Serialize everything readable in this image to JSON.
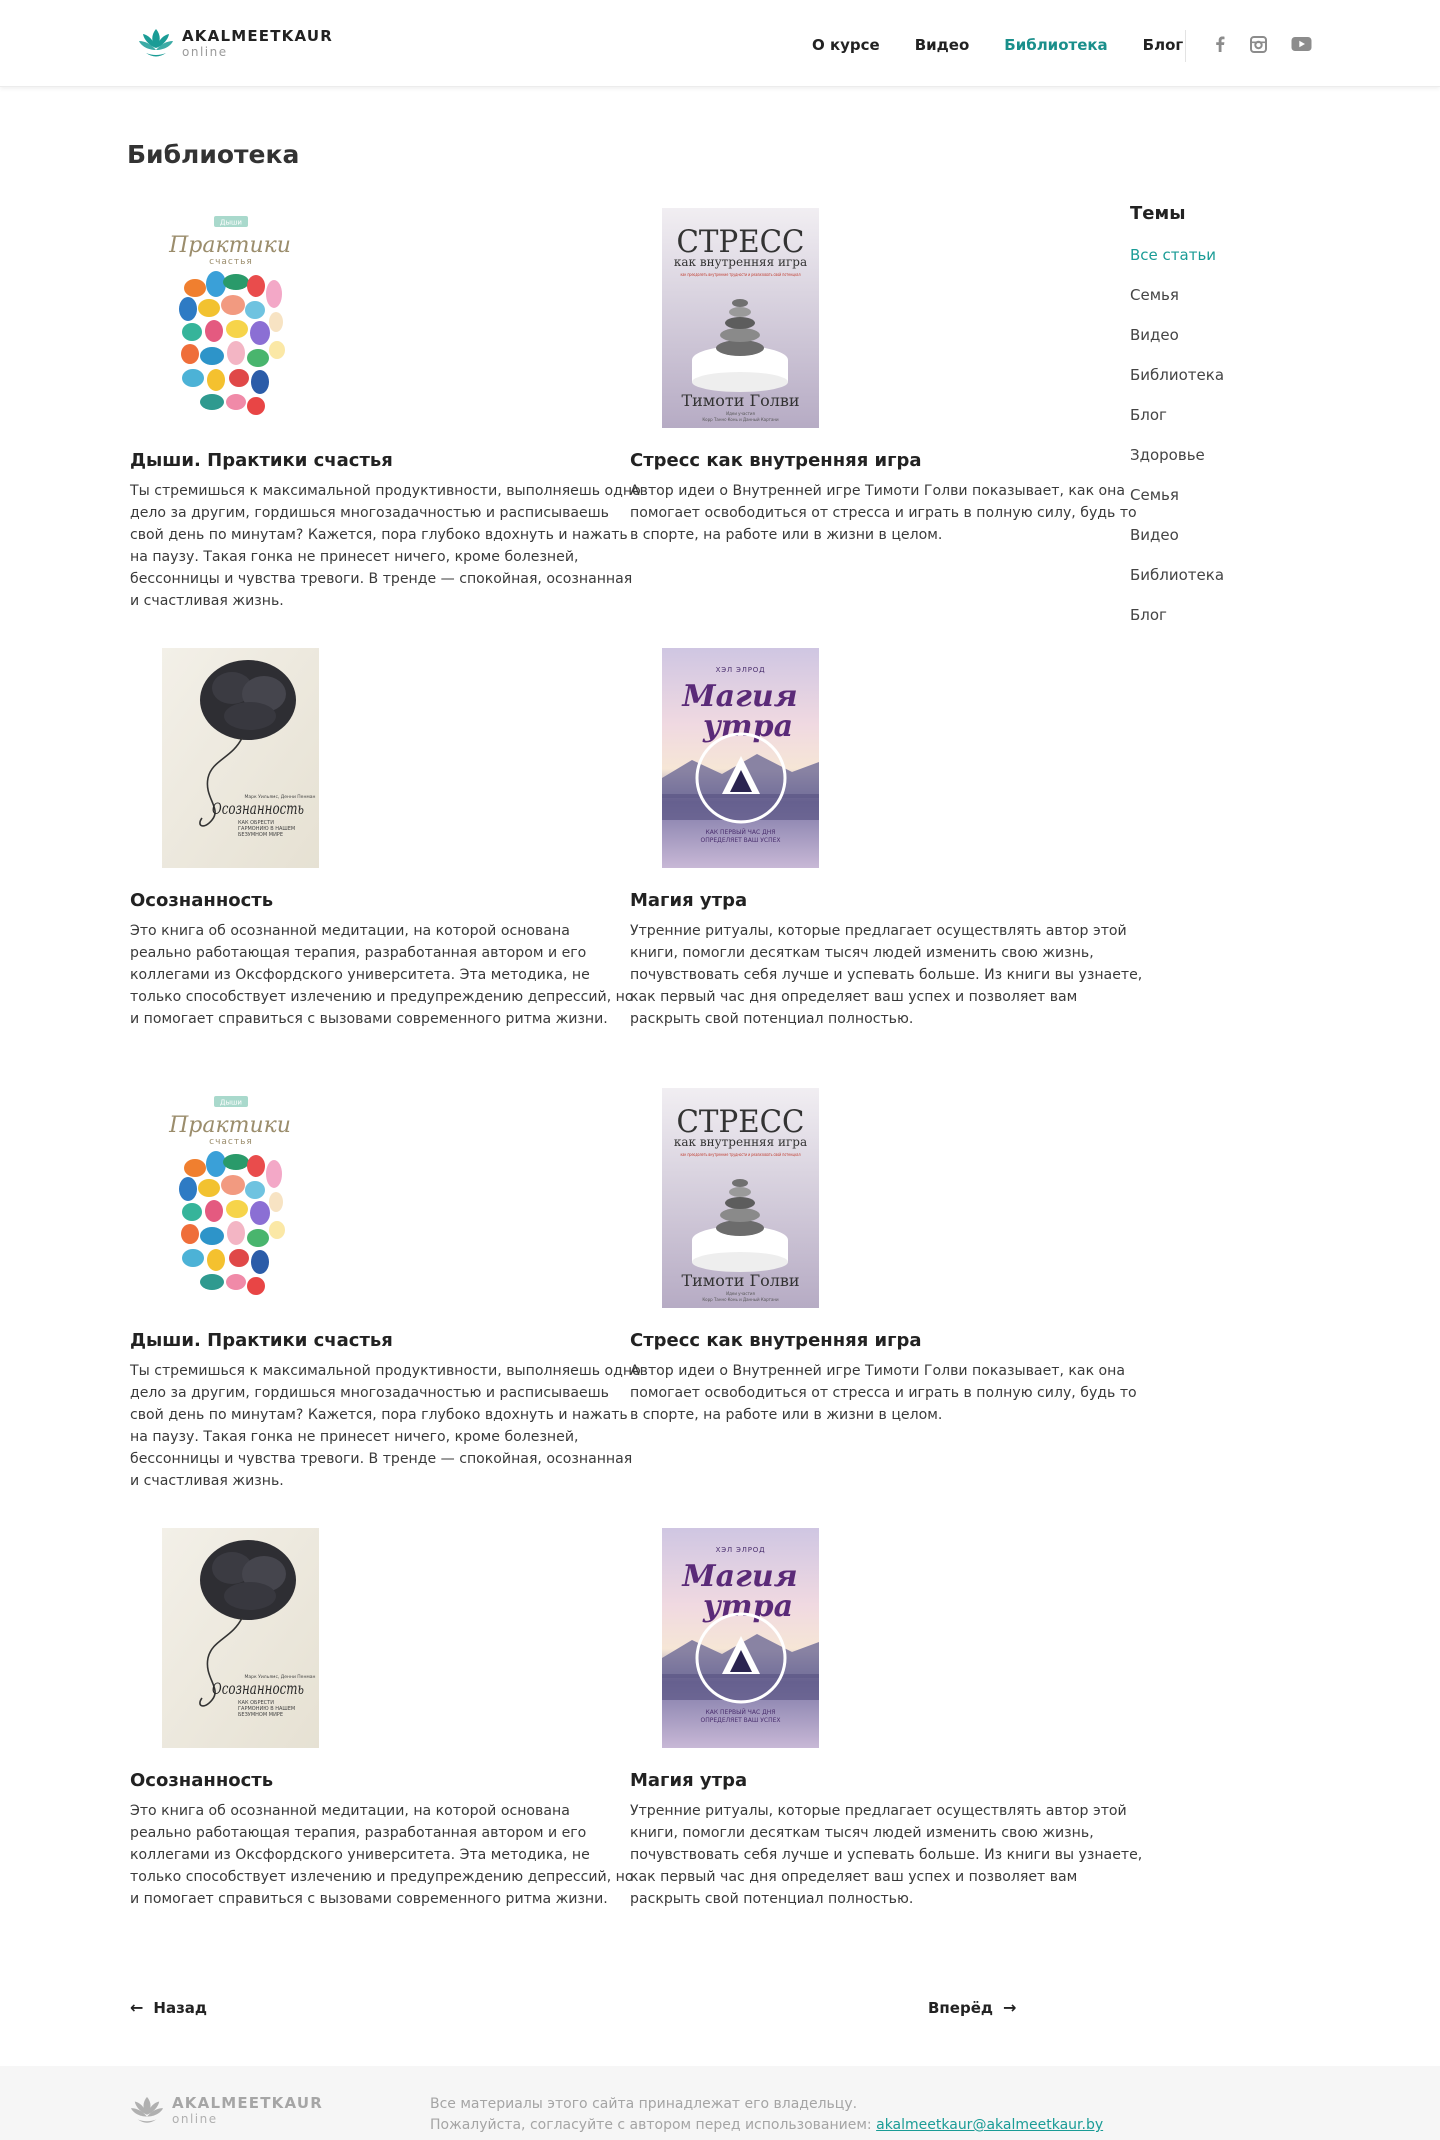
{
  "header": {
    "logo_name": "AKALMEETKAUR",
    "logo_sub": "online",
    "nav": [
      "О курсе",
      "Видео",
      "Библиотека",
      "Блог"
    ],
    "active_nav": "Библиотека",
    "social": [
      "facebook-icon",
      "instagram-icon",
      "youtube-icon"
    ]
  },
  "page_title": "Библиотека",
  "books": [
    {
      "title": "Дыши. Практики счастья",
      "cover": "praktiki",
      "desc": [
        "Ты стремишься к максимальной продуктивности, выполняешь одно",
        "дело за другим, гордишься многозадачностью и расписываешь",
        "свой день по минутам?  Кажется, пора глубоко вдохнуть и нажать",
        "на паузу. Такая гонка не принесет ничего, кроме болезней,",
        "бессонницы и чувства тревоги.  В тренде — спокойная, осознанная",
        "и счастливая жизнь."
      ]
    },
    {
      "title": "Стресс как внутренняя игра",
      "cover": "stress",
      "desc": [
        "Автор идеи о  Внутренней игре Тимоти  Голви показывает, как она",
        "помогает освободиться от стресса и играть в полную силу, будь то",
        "в спорте, на работе или в жизни в целом."
      ]
    },
    {
      "title": "Осознанность",
      "cover": "osoznannost",
      "desc": [
        "Это книга об осознанной медитации, на которой основана",
        "реально работающая терапия, разработанная автором и его",
        "коллегами из Оксфордского университета. Эта методика, не",
        "только способствует излечению и предупреждению депрессий, но",
        "и помогает справиться с вызовами современного ритма жизни."
      ]
    },
    {
      "title": "Магия утра",
      "cover": "magiya",
      "desc": [
        "Утренние ритуалы, которые предлагает осуществлять автор этой",
        "книги, помогли десяткам тысяч людей изменить свою жизнь,",
        "почувствовать себя лучше и успевать больше.  Из книги вы узнаете,",
        "как первый час дня определяет ваш успех и позволяет вам",
        "раскрыть свой потенциал полностью."
      ]
    },
    {
      "title": "Дыши. Практики счастья",
      "cover": "praktiki",
      "desc": [
        "Ты стремишься к максимальной продуктивности, выполняешь одно",
        "дело за другим, гордишься многозадачностью и расписываешь",
        "свой день по минутам?  Кажется, пора глубоко вдохнуть и нажать",
        "на паузу. Такая гонка не принесет ничего, кроме болезней,",
        "бессонницы и чувства тревоги.  В тренде — спокойная, осознанная",
        "и счастливая жизнь."
      ]
    },
    {
      "title": "Стресс как внутренняя игра",
      "cover": "stress",
      "desc": [
        "Автор идеи о  Внутренней игре Тимоти  Голви показывает, как она",
        "помогает освободиться от стресса и играть в полную силу, будь то",
        "в спорте, на работе или в жизни в целом."
      ]
    },
    {
      "title": "Осознанность",
      "cover": "osoznannost",
      "desc": [
        "Это книга об осознанной медитации, на которой основана",
        "реально работающая терапия, разработанная автором и его",
        "коллегами из Оксфордского университета. Эта методика, не",
        "только способствует излечению и предупреждению депрессий, но",
        "и помогает справиться с вызовами современного ритма жизни."
      ]
    },
    {
      "title": "Магия утра",
      "cover": "magiya",
      "desc": [
        "Утренние ритуалы, которые предлагает осуществлять автор этой",
        "книги, помогли десяткам тысяч людей изменить свою жизнь,",
        "почувствовать себя лучше и успевать больше.  Из книги вы узнаете,",
        "как первый час дня определяет ваш успех и позволяет вам",
        "раскрыть свой потенциал полностью."
      ]
    }
  ],
  "covers": {
    "praktiki": {
      "brand": "Дыши",
      "title": "Практики",
      "subtitle": "счастья"
    },
    "stress": {
      "title": "СТРЕСС",
      "subtitle": "как внутренняя игра",
      "tagline": "как преодолеть внутренние трудности и реализовать свой потенциал",
      "author": "Тимоти Голви",
      "credit": "Идеи участия",
      "credit2": "Корр Таннс·Конь и Данный Картани"
    },
    "osoznannost": {
      "authors": "Марк Уильямс, Денни Пенман",
      "title": "Осознанность",
      "subtitle": "как обрести гармонию в нашем безумном мире"
    },
    "magiya": {
      "author": "ХЭЛ ЭЛРОД",
      "title_1": "Магия",
      "title_2": "утра",
      "subtitle_1": "КАК ПЕРВЫЙ ЧАС ДНЯ",
      "subtitle_2": "ОПРЕДЕЛЯЕТ ВАШ УСПЕХ"
    }
  },
  "sidebar": {
    "title": "Темы",
    "items": [
      "Все статьи",
      "Семья",
      "Видео",
      "Библиотека",
      "Блог",
      "Здоровье",
      "Семья",
      "Видео",
      "Библиотека",
      "Блог"
    ],
    "active_item": "Все статьи"
  },
  "pager": {
    "prev": "Назад",
    "next": "Вперёд",
    "prev_arrow": "←",
    "next_arrow": "→"
  },
  "footer": {
    "logo_name": "AKALMEETKAUR",
    "logo_sub": "online",
    "line1": "Все материалы этого сайта принадлежат его владельцу.",
    "line2": "Пожалуйста, согласуйте с автором перед использованием: ",
    "email": "akalmeetkaur@akalmeetkaur.by"
  },
  "colors": {
    "accent": "#1a8f8b",
    "text": "#333333",
    "footer_bg": "#f6f6f6"
  }
}
